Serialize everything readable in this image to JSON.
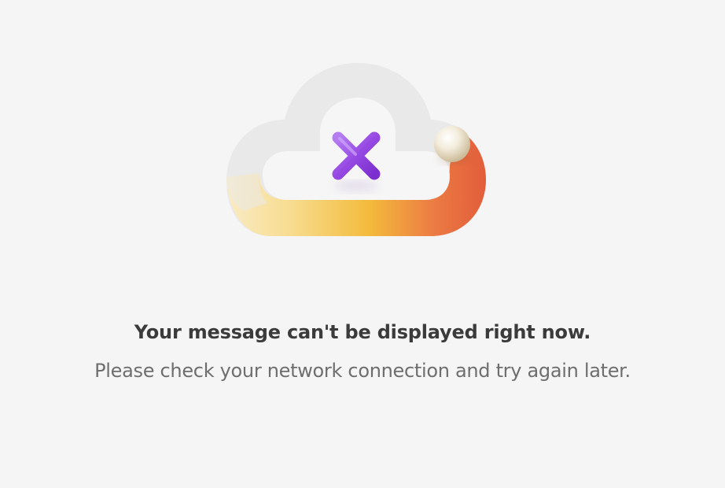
{
  "error": {
    "title": "Your message can't be displayed right now.",
    "subtitle": "Please check your network connection and try again later."
  },
  "illustration": {
    "cloud_icon": "cloud-offline-icon",
    "x_icon": "error-x-icon",
    "colors": {
      "cloud": "#e8e8e8",
      "gradient_start": "#f7df9a",
      "gradient_mid": "#f2b93a",
      "gradient_end": "#e8603c",
      "x_mark": "#9b4fe0",
      "pearl": "#f1ead9"
    }
  }
}
